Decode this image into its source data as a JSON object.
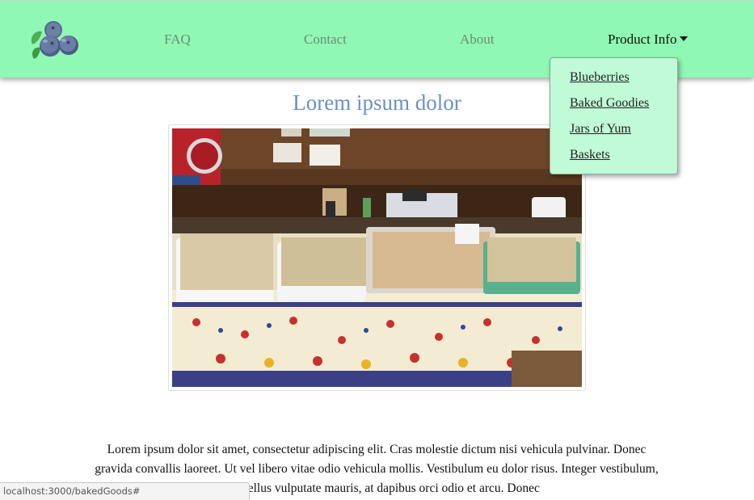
{
  "nav": {
    "logo_icon": "blueberries-logo-icon",
    "links": [
      "FAQ",
      "Contact",
      "About"
    ],
    "product_menu": {
      "label": "Product Info",
      "items": [
        "Blueberries",
        "Baked Goodies",
        "Jars of Yum",
        "Baskets"
      ]
    },
    "colors": {
      "background": "#8ff8b4",
      "dropdown": "#c0fad6"
    }
  },
  "main": {
    "title": "Lorem ipsum dolor",
    "image_icon": "market-table-photo",
    "paragraph": "Lorem ipsum dolor sit amet, consectetur adipiscing elit. Cras molestie dictum nisi vehicula pulvinar. Donec gravida convallis laoreet. Ut vel libero vitae odio vehicula mollis. Vestibulum eu dolor risus. Integer vestibulum, purus tellus vulputate mauris, at dapibus orci odio et arcu. Donec"
  },
  "status_bar": {
    "url": "localhost:3000/bakedGoods#"
  }
}
